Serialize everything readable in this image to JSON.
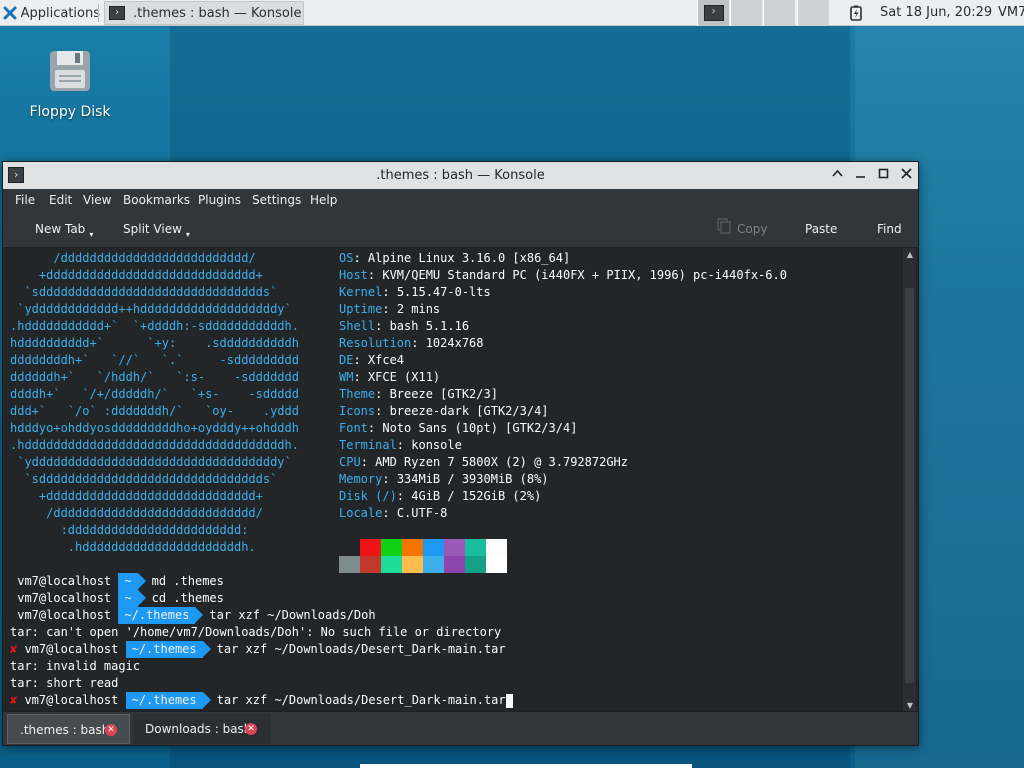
{
  "taskbar": {
    "apps_label": "Applications",
    "task_title": ".themes : bash — Konsole",
    "clock": "Sat 18 Jun, 20:29",
    "user": "VM7"
  },
  "desktop": {
    "icons": [
      {
        "label": "Floppy Disk"
      }
    ]
  },
  "window": {
    "title": ".themes : bash — Konsole",
    "menu": [
      "File",
      "Edit",
      "View",
      "Bookmarks",
      "Plugins",
      "Settings",
      "Help"
    ],
    "toolbar": {
      "new_tab": "New Tab",
      "split_view": "Split View",
      "copy": "Copy",
      "paste": "Paste",
      "find": "Find"
    }
  },
  "terminal": {
    "logo_lines": [
      "      /dddddddddddddddddddddddddd/",
      "    +ddddddddddddddddddddddddddddd+",
      "  `sddddddddddddddddddddddddddddddds`",
      " `ydddddddddddd++hdddddddddddddddddddy`",
      ".hddddddddddd+`  `+ddddh:-sdddddddddddh.",
      "hdddddddddd+`      `+y:    .sddddddddddh",
      "ddddddddh+`   `//`   `.`     -sddddddddd",
      "ddddddh+`   `/hddh/`   `:s-    -sddddddd",
      "ddddh+`   `/+/dddddh/`   `+s-    -sddddd",
      "ddd+`   `/o` :dddddddh/`   `oy-    .yddd",
      "hdddyo+ohddyosdddddddddho+oydddy++ohdddh",
      ".hddddddddddddddddddddddddddddddddddddh.",
      " `yddddddddddddddddddddddddddddddddddy`",
      "  `sddddddddddddddddddddddddddddddds`",
      "    +ddddddddddddddddddddddddddddd+",
      "     /dddddddddddddddddddddddddddd/",
      "       :dddddddddddddddddddddddd:",
      "        .hddddddddddddddddddddddh."
    ],
    "info": [
      {
        "key": "OS",
        "value": "Alpine Linux 3.16.0 [x86_64]"
      },
      {
        "key": "Host",
        "value": "KVM/QEMU Standard PC (i440FX + PIIX, 1996) pc-i440fx-6.0"
      },
      {
        "key": "Kernel",
        "value": "5.15.47-0-lts"
      },
      {
        "key": "Uptime",
        "value": "2 mins"
      },
      {
        "key": "Shell",
        "value": "bash 5.1.16"
      },
      {
        "key": "Resolution",
        "value": "1024x768"
      },
      {
        "key": "DE",
        "value": "Xfce4"
      },
      {
        "key": "WM",
        "value": "XFCE (X11)"
      },
      {
        "key": "Theme",
        "value": "Breeze [GTK2/3]"
      },
      {
        "key": "Icons",
        "value": "breeze-dark [GTK2/3/4]"
      },
      {
        "key": "Font",
        "value": "Noto Sans (10pt) [GTK2/3/4]"
      },
      {
        "key": "Terminal",
        "value": "konsole"
      },
      {
        "key": "CPU",
        "value": "AMD Ryzen 7 5800X (2) @ 3.792872GHz"
      },
      {
        "key": "Memory",
        "value": "334MiB / 3930MiB (8%)"
      },
      {
        "key": "Disk (/)",
        "value": "4GiB / 152GiB (2%)"
      },
      {
        "key": "Locale",
        "value": "C.UTF-8"
      }
    ],
    "swatches_top": [
      "#232629",
      "#ed1515",
      "#11d116",
      "#f67400",
      "#1d99f3",
      "#9b59b6",
      "#1abc9c",
      "#fcfcfc"
    ],
    "swatches_bottom": [
      "#7f8c8d",
      "#c0392b",
      "#1cdc9a",
      "#fdbc4b",
      "#3daee9",
      "#8e44ad",
      "#16a085",
      "#ffffff"
    ],
    "lines": [
      {
        "type": "prompt",
        "host": "vm7@localhost",
        "dir": "~",
        "cmd": "md .themes",
        "error": false
      },
      {
        "type": "prompt",
        "host": "vm7@localhost",
        "dir": "~",
        "cmd": "cd .themes",
        "error": false
      },
      {
        "type": "prompt",
        "host": "vm7@localhost",
        "dir": "~/.themes",
        "cmd": "tar xzf ~/Downloads/Doh",
        "error": false
      },
      {
        "type": "output",
        "text": "tar: can't open '/home/vm7/Downloads/Doh': No such file or directory"
      },
      {
        "type": "prompt",
        "host": "vm7@localhost",
        "dir": "~/.themes",
        "cmd": "tar xzf ~/Downloads/Desert_Dark-main.tar",
        "error": true
      },
      {
        "type": "output",
        "text": "tar: invalid magic"
      },
      {
        "type": "output",
        "text": "tar: short read"
      },
      {
        "type": "prompt",
        "host": "vm7@localhost",
        "dir": "~/.themes",
        "cmd": "tar xzf ~/Downloads/Desert_Dark-main.tar",
        "error": true,
        "cursor": true
      }
    ]
  },
  "tabs": [
    {
      "label": ".themes : bash",
      "active": true
    },
    {
      "label": "Downloads : bash",
      "active": false
    }
  ]
}
